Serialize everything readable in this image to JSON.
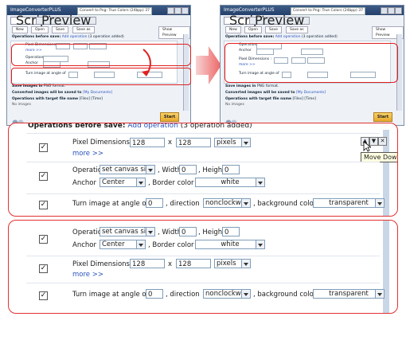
{
  "app": {
    "title": "ImageConverterPLUS",
    "preset": "Convert to Png: True Colors (24bpp) 37",
    "tabs": [
      "Script",
      "Preview"
    ],
    "toolbar": [
      "New",
      "Open",
      "Save",
      "Save as"
    ],
    "show_preview": "Show Preview",
    "ops_header": "Operations before save:",
    "add_operation": "Add operation",
    "ops_added": "(3 operation added)",
    "save_images_in": "Save images in",
    "format_value": "PNG",
    "format_suffix": "format.",
    "converted_saved_to": "Converted images will be saved to",
    "folder_value": "[My Documents]",
    "folder_suffix": "folder",
    "target_file_name": "Operations with target file name",
    "target_value": "[Files] [Time]",
    "no_images": "No images",
    "start": "Start"
  },
  "ops": {
    "pixel_dimensions": "Pixel Dimensions :",
    "width_value": "128",
    "x": "x",
    "height_value": "128",
    "units": "pixels",
    "more": "more >>",
    "operation_label": "Operation",
    "operation_value": "set canvas size",
    "width_label": ", Width",
    "width_field": "0",
    "height_label": ", Height",
    "height_field": "0",
    "anchor_label": "Anchor",
    "anchor_value": "Center",
    "border_color_label": ", Border color",
    "border_color_value": "white",
    "turn_label": "Turn image at angle of",
    "angle_value": "0",
    "direction_label": ", direction",
    "direction_value": "nonclockwise",
    "bg_color_label": ", background color",
    "bg_color_value": "transparent"
  },
  "tooltip": "Move Down",
  "colors": {
    "highlight": "#e02020",
    "accent": "#2a52be",
    "titlebar": "#23406a"
  }
}
